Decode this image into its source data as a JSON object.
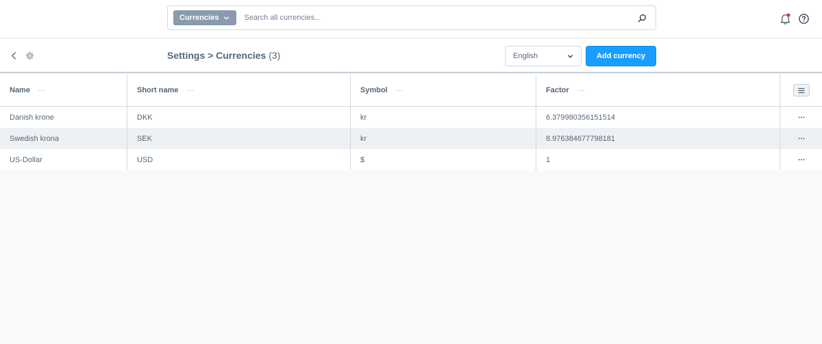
{
  "header": {
    "search_type_label": "Currencies",
    "search_placeholder": "Search all currencies..."
  },
  "smartbar": {
    "breadcrumb": "Settings > Currencies",
    "count": "(3)",
    "language": "English",
    "add_button_label": "Add currency"
  },
  "grid": {
    "columns": [
      "Name",
      "Short name",
      "Symbol",
      "Factor"
    ],
    "rows": [
      {
        "name": "Danish krone",
        "short_name": "DKK",
        "symbol": "kr",
        "factor": "6.379980356151514"
      },
      {
        "name": "Swedish krona",
        "short_name": "SEK",
        "symbol": "kr",
        "factor": "8.976384677798181"
      },
      {
        "name": "US-Dollar",
        "short_name": "USD",
        "symbol": "$",
        "factor": "1"
      }
    ]
  },
  "icons": {
    "search": "search-icon",
    "notifications": "bell-icon",
    "help": "help-icon",
    "back": "chevron-left-icon",
    "settings": "gear-icon",
    "column_settings": "list-icon",
    "row_actions": "more-icon"
  },
  "colors": {
    "primary": "#189eff",
    "notification_dot": "#de294c",
    "search_type_bg": "#8a9bad",
    "stripe": "#eef1f4"
  }
}
